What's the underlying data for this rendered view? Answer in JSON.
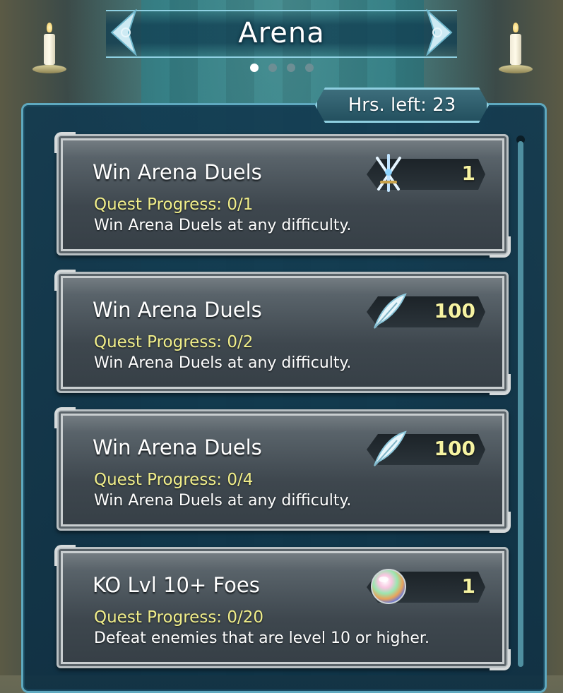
{
  "header": {
    "title": "Arena",
    "page_indicator": {
      "total": 4,
      "active_index": 0
    }
  },
  "timer": {
    "label": "Hrs. left: 23"
  },
  "quests": [
    {
      "title": "Win Arena Duels",
      "progress": "Quest Progress: 0/1",
      "description": "Win Arena Duels at any difficulty.",
      "reward": {
        "icon": "duel-swords-icon",
        "amount": "1"
      }
    },
    {
      "title": "Win Arena Duels",
      "progress": "Quest Progress: 0/2",
      "description": "Win Arena Duels at any difficulty.",
      "reward": {
        "icon": "feather-icon",
        "amount": "100"
      }
    },
    {
      "title": "Win Arena Duels",
      "progress": "Quest Progress: 0/4",
      "description": "Win Arena Duels at any difficulty.",
      "reward": {
        "icon": "feather-icon",
        "amount": "100"
      }
    },
    {
      "title": "KO Lvl 10+ Foes",
      "progress": "Quest Progress: 0/20",
      "description": "Defeat enemies that are level 10 or higher.",
      "reward": {
        "icon": "orb-icon",
        "amount": "1"
      }
    }
  ],
  "colors": {
    "progress_text": "#f1ee8a",
    "reward_amount": "#f6f3a2",
    "panel_border": "#5fa9bf"
  }
}
